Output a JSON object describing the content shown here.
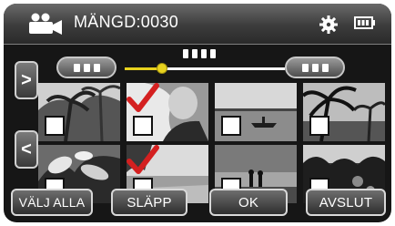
{
  "header": {
    "count_text": "MÄNGD:0030",
    "mode_icon": "video-camera-icon",
    "settings_icon": "gear-icon",
    "battery_icon": "battery-icon"
  },
  "date_bar": {
    "prev_icon": "date-prev-button",
    "next_icon": "date-next-button",
    "slider_position": 0.2
  },
  "nav": {
    "page_up_icon": "chevron-right-icon",
    "page_down_icon": "chevron-left-icon",
    "page_up_label": ">",
    "page_down_label": "<"
  },
  "thumbnails": [
    {
      "scene": "palm-trees",
      "checked": false
    },
    {
      "scene": "person-portrait",
      "checked": true
    },
    {
      "scene": "boat-on-sea",
      "checked": false
    },
    {
      "scene": "palm-sunset",
      "checked": false
    },
    {
      "scene": "plants-closeup",
      "checked": false
    },
    {
      "scene": "beach-landscape",
      "checked": true
    },
    {
      "scene": "couple-on-beach",
      "checked": false
    },
    {
      "scene": "tropical-garden",
      "checked": false
    }
  ],
  "buttons": {
    "select_all": "VÄLJ ALLA",
    "release": "SLÄPP",
    "ok": "OK",
    "finish": "AVSLUT"
  },
  "colors": {
    "accent": "#e8d21e",
    "checkmark": "#d42020"
  }
}
